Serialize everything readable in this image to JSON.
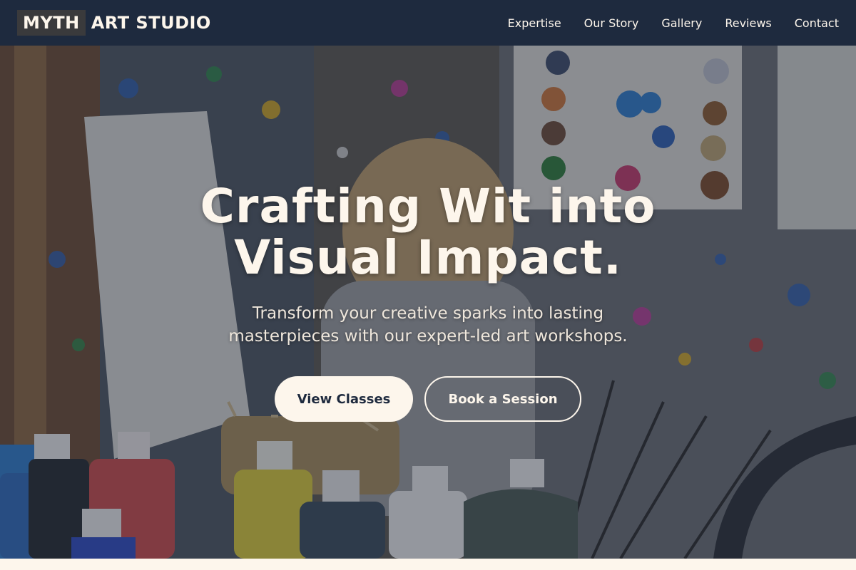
{
  "brand": {
    "logo_box": "MYTH",
    "logo_rest": "ART STUDIO"
  },
  "nav": {
    "links": [
      "Expertise",
      "Our Story",
      "Gallery",
      "Reviews",
      "Contact"
    ]
  },
  "hero": {
    "headline": "Crafting Wit into Visual Impact.",
    "subtext": "Transform your creative sparks into lasting masterpieces with our expert-led art workshops.",
    "primary_cta": "View Classes",
    "secondary_cta": "Book a Session"
  },
  "colors": {
    "nav_bg": "#1e2a3e",
    "cream": "#fdf6ec",
    "button_text": "#1e2a3e"
  }
}
